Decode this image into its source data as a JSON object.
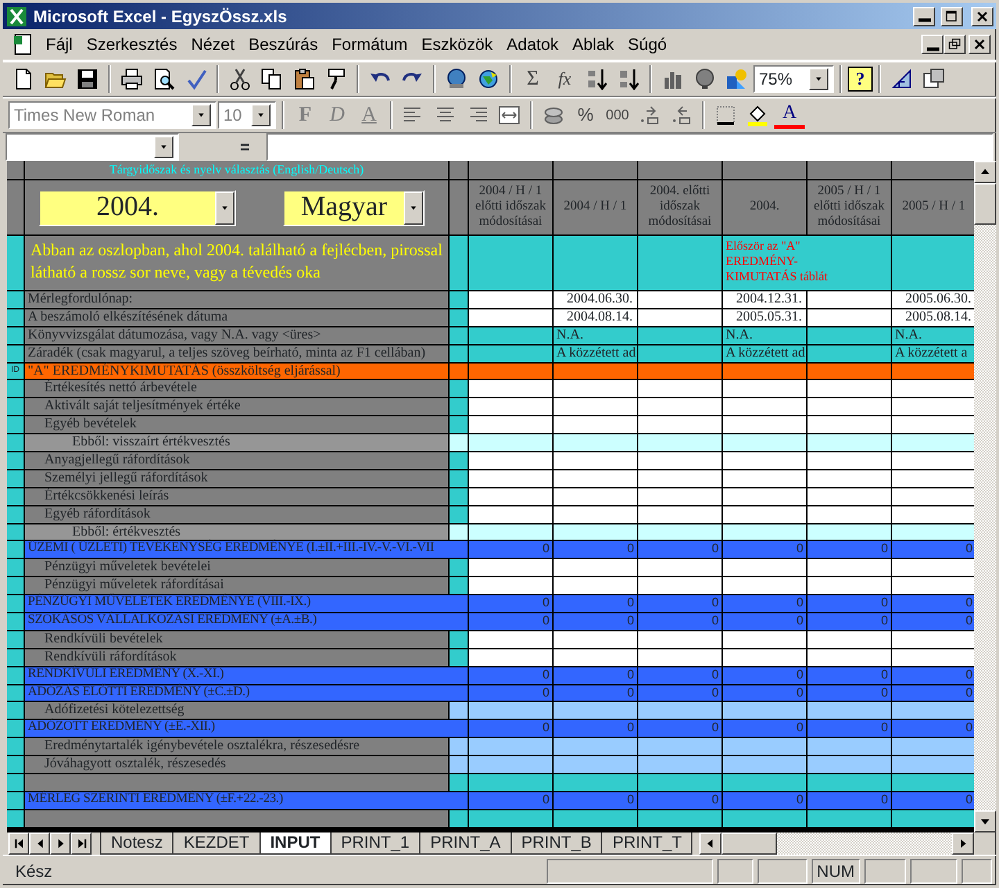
{
  "window": {
    "title": "Microsoft Excel - EgyszÖssz.xls"
  },
  "menu": [
    "Fájl",
    "Szerkesztés",
    "Nézet",
    "Beszúrás",
    "Formátum",
    "Eszközök",
    "Adatok",
    "Ablak",
    "Súgó"
  ],
  "toolbar_standard": {
    "autosum": "Σ",
    "function": "fx",
    "zoom": "75%",
    "help": "?"
  },
  "toolbar_format": {
    "font": "Times New Roman",
    "size": "10",
    "bold": "F",
    "italic": "D",
    "underline": "A",
    "percent": "%",
    "thousands": "000",
    "font_color": "A",
    "disabled": true
  },
  "formula_bar": {
    "equals": "="
  },
  "sheet": {
    "selector_title": "Tárgyidőszak és nyelv választás  (English/Deutsch)",
    "year": "2004.",
    "language": "Magyar",
    "instruction": "Abban az oszlopban, ahol 2004. található a fejlécben, pirossal látható a rossz sor neve, vagy a tévedés oka",
    "columns": [
      {
        "header": "2004 / H / 1 előtti időszak módosításai"
      },
      {
        "header": "2004 / H / 1"
      },
      {
        "header": "2004. előtti időszak módosításai"
      },
      {
        "header": "2004.",
        "note": "Először az \"A\" EREDMÉNY-KIMUTATÁS táblát"
      },
      {
        "header": "2005 / H / 1 előtti időszak módosításai"
      },
      {
        "header": "2005 / H / 1"
      }
    ],
    "rows": [
      {
        "label": "Mérlegfordulónap:",
        "kind": "date",
        "cells": [
          null,
          "2004.06.30.",
          null,
          "2004.12.31.",
          null,
          "2005.06.30."
        ]
      },
      {
        "label": "A beszámoló elkészítésének dátuma",
        "kind": "date",
        "cells": [
          null,
          "2004.08.14.",
          null,
          "2005.05.31.",
          null,
          "2005.08.14."
        ]
      },
      {
        "label": "Könyvvizsgálat dátumozása, vagy N.A. vagy <üres>",
        "kind": "text",
        "cells": [
          null,
          "N.A.",
          null,
          "N.A.",
          null,
          "N.A."
        ]
      },
      {
        "label": "Záradék (csak magyarul, a teljes szöveg beírható, minta az F1 cellában)",
        "kind": "text",
        "cells": [
          null,
          "A közzétett ad",
          null,
          "A közzétett ad",
          null,
          "A közzétett a"
        ]
      },
      {
        "label": "\"A\" EREDMÉNYKIMUTATÁS (összköltség eljárással)",
        "kind": "section",
        "marker": "ID"
      },
      {
        "label": "Értékesítés nettó árbevétele",
        "kind": "item"
      },
      {
        "label": "Aktivált saját teljesítmények értéke",
        "kind": "item"
      },
      {
        "label": "Egyéb bevételek",
        "kind": "item"
      },
      {
        "label": "Ebből: visszaírt értékvesztés",
        "kind": "sub"
      },
      {
        "label": "Anyagjellegű ráfordítások",
        "kind": "item"
      },
      {
        "label": "Személyi jellegű ráfordítások",
        "kind": "item"
      },
      {
        "label": "Értékcsökkenési leírás",
        "kind": "item"
      },
      {
        "label": "Egyéb ráfordítások",
        "kind": "item"
      },
      {
        "label": "Ebből: értékvesztés",
        "kind": "sub"
      },
      {
        "label": "ÜZEMI ( ÜZLETI) TEVÉKENYSÉG EREDMÉNYE (I.±II.+III.-IV.-V.-VI.-VII",
        "kind": "total",
        "cells": [
          "0",
          "0",
          "0",
          "0",
          "0",
          "0"
        ]
      },
      {
        "label": "Pénzügyi műveletek bevételei",
        "kind": "item"
      },
      {
        "label": "Pénzügyi műveletek ráfordításai",
        "kind": "item"
      },
      {
        "label": "PÉNZÜGYI MŰVELETEK EREDMÉNYE (VIII.-IX.)",
        "kind": "total",
        "cells": [
          "0",
          "0",
          "0",
          "0",
          "0",
          "0"
        ]
      },
      {
        "label": "SZOKÁSOS VÁLLALKOZÁSI EREDMÉNY (±A.±B.)",
        "kind": "total",
        "cells": [
          "0",
          "0",
          "0",
          "0",
          "0",
          "0"
        ]
      },
      {
        "label": "Rendkívüli bevételek",
        "kind": "item"
      },
      {
        "label": "Rendkívüli ráfordítások",
        "kind": "item"
      },
      {
        "label": "RENDKÍVÜLI EREDMÉNY (X.-XI.)",
        "kind": "total",
        "cells": [
          "0",
          "0",
          "0",
          "0",
          "0",
          "0"
        ]
      },
      {
        "label": "ADÓZÁS ELŐTTI EREDMÉNY (±C.±D.)",
        "kind": "total",
        "cells": [
          "0",
          "0",
          "0",
          "0",
          "0",
          "0"
        ]
      },
      {
        "label": "Adófizetési kötelezettség",
        "kind": "light"
      },
      {
        "label": "ADÓZOTT EREDMÉNY (±E.-XII.)",
        "kind": "total",
        "cells": [
          "0",
          "0",
          "0",
          "0",
          "0",
          "0"
        ]
      },
      {
        "label": "Eredménytartalék igénybevétele osztalékra, részesedésre",
        "kind": "light"
      },
      {
        "label": "Jóváhagyott osztalék, részesedés",
        "kind": "light"
      },
      {
        "kind": "blank"
      },
      {
        "label": "MÉRLEG SZERINTI EREDMÉNY (±F.+22.-23.)",
        "kind": "total",
        "cells": [
          "0",
          "0",
          "0",
          "0",
          "0",
          "0"
        ]
      },
      {
        "kind": "blank"
      }
    ]
  },
  "sheet_tabs": [
    {
      "label": "Notesz",
      "selected": false
    },
    {
      "label": "KEZDET",
      "selected": false
    },
    {
      "label": "INPUT",
      "selected": true
    },
    {
      "label": "PRINT_1",
      "selected": false
    },
    {
      "label": "PRINT_A",
      "selected": false
    },
    {
      "label": "PRINT_B",
      "selected": false
    },
    {
      "label": "PRINT_T",
      "selected": false
    }
  ],
  "status_bar": {
    "text": "Kész",
    "num": "NUM"
  }
}
